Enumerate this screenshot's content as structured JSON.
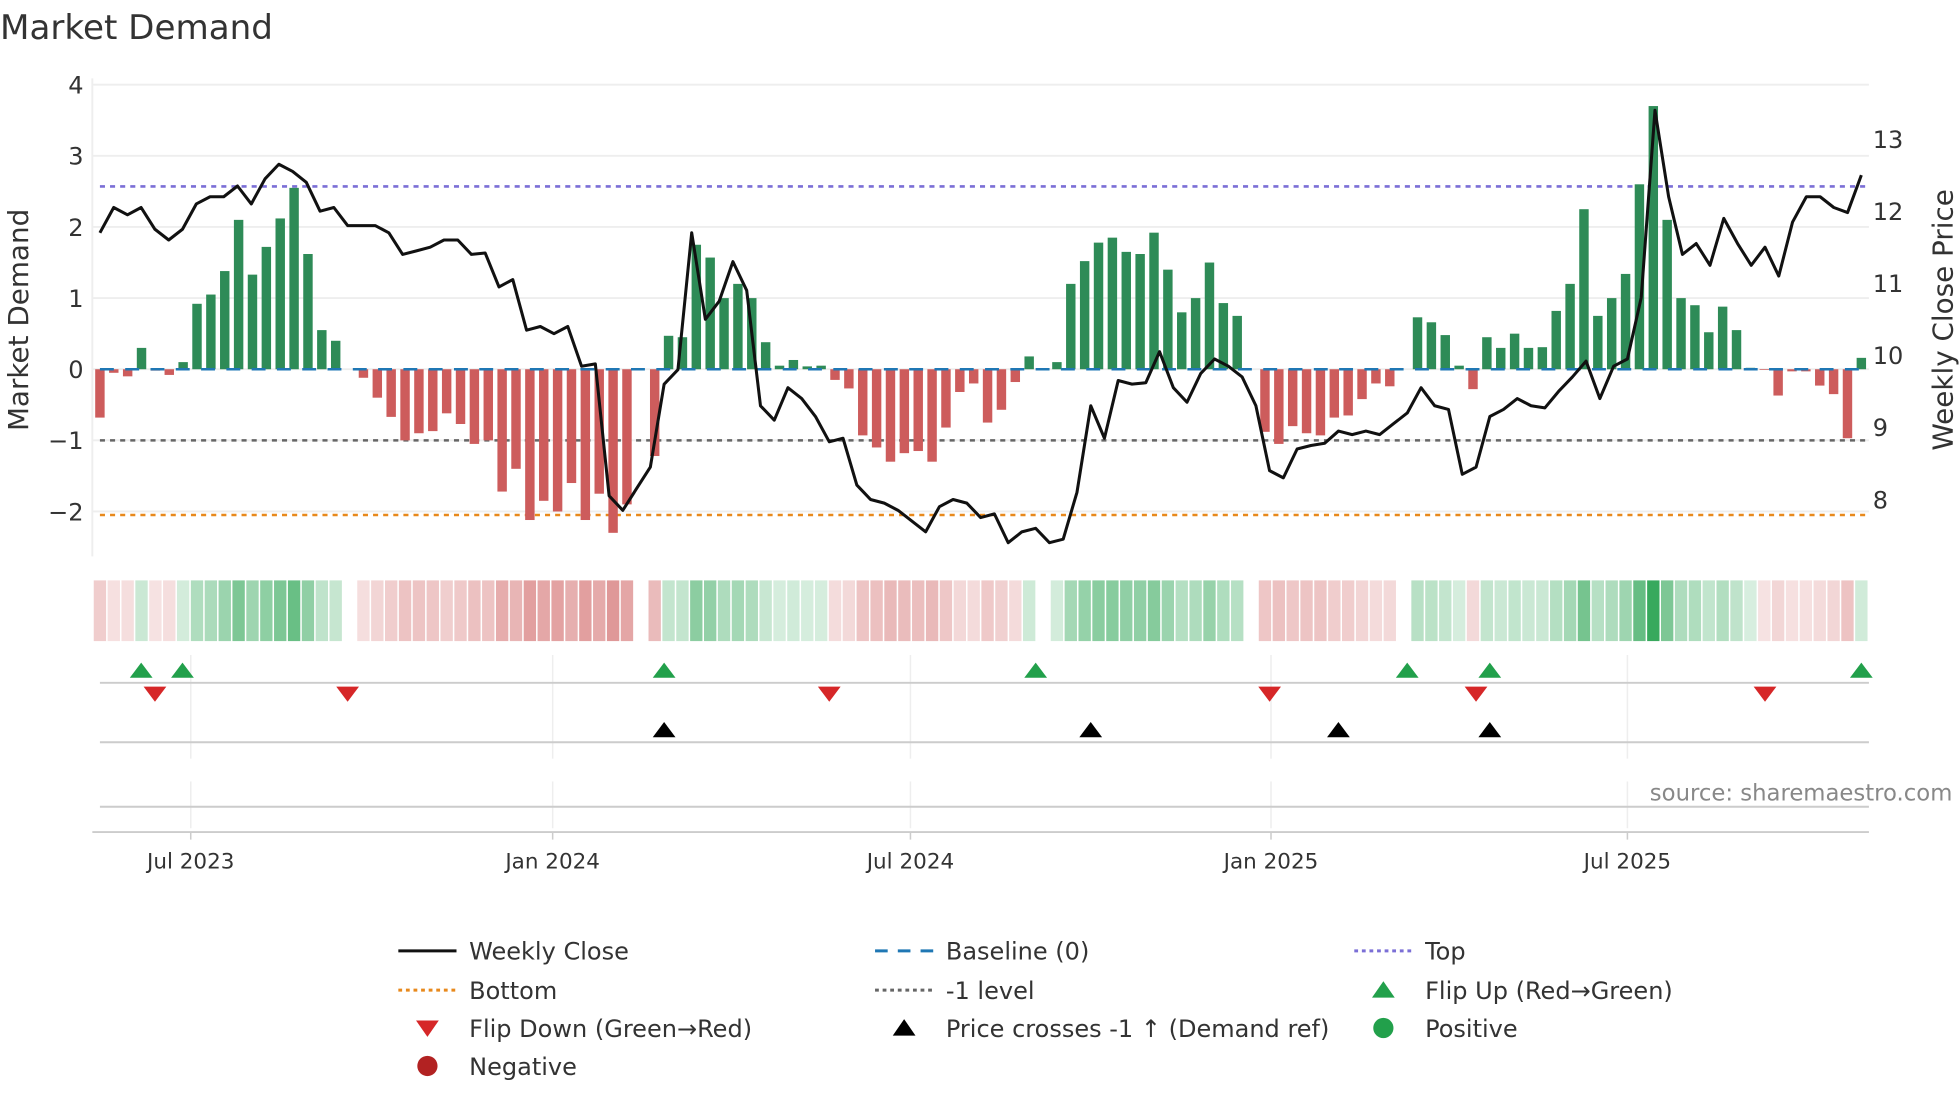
{
  "title": "Market Demand",
  "source": "source: sharemaestro.com",
  "colors": {
    "positive": "#2e8b57",
    "negative": "#cd5c5c",
    "price": "#111111",
    "baseline": "#1f77b4",
    "top": "#7b6fd6",
    "bottom": "#e8891c",
    "minus_one": "#666666",
    "flip_up": "#22a04b",
    "flip_down": "#d62728",
    "cross": "#000000",
    "negative_dot": "#b22222"
  },
  "chart_data": {
    "type": "bar",
    "title": "Market Demand",
    "ylabel": "Market Demand",
    "y2label": "Weekly Close Price",
    "ylim": [
      -2.7,
      4.1
    ],
    "y2lim": [
      7.15,
      13.85
    ],
    "yticks": [
      "4",
      "3",
      "2",
      "1",
      "0",
      "−1",
      "−2"
    ],
    "ytick_values": [
      4,
      3,
      2,
      1,
      0,
      -1,
      -2
    ],
    "y2ticks": [
      "13",
      "12",
      "11",
      "10",
      "9",
      "8"
    ],
    "y2tick_values": [
      13,
      12,
      11,
      10,
      9,
      8
    ],
    "xticks": [
      "Jul 2023",
      "Jan 2024",
      "Jul 2024",
      "Jan 2025",
      "Jul 2025"
    ],
    "xtick_weeks": [
      6.6,
      32.9,
      58.9,
      85.1,
      111.0
    ],
    "weeks_total": 128,
    "levels": {
      "top": 2.57,
      "bottom": -2.05,
      "minus_one": -1.0,
      "baseline": 0
    },
    "demand": [
      -0.68,
      -0.05,
      -0.1,
      0.3,
      -0.02,
      -0.08,
      0.1,
      0.92,
      1.05,
      1.38,
      2.1,
      1.33,
      1.72,
      2.12,
      2.55,
      1.62,
      0.55,
      0.4,
      0,
      -0.12,
      -0.4,
      -0.67,
      -1.0,
      -0.9,
      -0.87,
      -0.62,
      -0.77,
      -1.05,
      -1.0,
      -1.72,
      -1.4,
      -2.12,
      -1.85,
      -2.0,
      -1.6,
      -2.12,
      -1.75,
      -2.3,
      -1.9,
      0,
      -1.22,
      0.47,
      0.45,
      1.75,
      1.57,
      1.0,
      1.2,
      1.0,
      0.38,
      0.05,
      0.13,
      0.04,
      0.05,
      -0.15,
      -0.27,
      -0.93,
      -1.1,
      -1.3,
      -1.18,
      -1.15,
      -1.3,
      -0.82,
      -0.32,
      -0.2,
      -0.75,
      -0.57,
      -0.18,
      0.18,
      0.0,
      0.1,
      1.2,
      1.52,
      1.78,
      1.85,
      1.65,
      1.62,
      1.92,
      1.4,
      0.8,
      1.0,
      1.5,
      0.93,
      0.75,
      0.0,
      -0.88,
      -1.05,
      -0.8,
      -0.9,
      -0.93,
      -0.68,
      -0.65,
      -0.42,
      -0.2,
      -0.24,
      0.0,
      0.73,
      0.66,
      0.48,
      0.05,
      -0.28,
      0.45,
      0.3,
      0.5,
      0.3,
      0.31,
      0.82,
      1.2,
      2.25,
      0.75,
      1.0,
      1.34,
      2.6,
      3.7,
      2.1,
      1.0,
      0.9,
      0.52,
      0.88,
      0.55,
      0.02,
      -0.01,
      -0.37,
      -0.03,
      -0.03,
      -0.23,
      -0.35,
      -0.97,
      0.16
    ],
    "price": [
      11.7,
      12.05,
      11.95,
      12.05,
      11.75,
      11.6,
      11.75,
      12.1,
      12.2,
      12.2,
      12.35,
      12.1,
      12.45,
      12.65,
      12.55,
      12.4,
      12.0,
      12.05,
      11.8,
      11.8,
      11.8,
      11.7,
      11.4,
      11.45,
      11.5,
      11.6,
      11.6,
      11.4,
      11.42,
      10.95,
      11.05,
      10.35,
      10.4,
      10.3,
      10.4,
      9.85,
      9.88,
      8.05,
      7.85,
      8.15,
      8.45,
      9.6,
      9.8,
      11.7,
      10.5,
      10.75,
      11.3,
      10.9,
      9.3,
      9.1,
      9.55,
      9.4,
      9.15,
      8.8,
      8.85,
      8.2,
      8.0,
      7.95,
      7.85,
      7.7,
      7.55,
      7.9,
      8.0,
      7.95,
      7.75,
      7.8,
      7.4,
      7.55,
      7.6,
      7.4,
      7.45,
      8.1,
      9.3,
      8.85,
      9.65,
      9.6,
      9.62,
      10.05,
      9.55,
      9.35,
      9.75,
      9.95,
      9.85,
      9.7,
      9.3,
      8.4,
      8.3,
      8.7,
      8.75,
      8.78,
      8.95,
      8.9,
      8.95,
      8.9,
      9.05,
      9.2,
      9.55,
      9.3,
      9.25,
      8.35,
      8.45,
      9.15,
      9.25,
      9.4,
      9.3,
      9.27,
      9.5,
      9.7,
      9.92,
      9.4,
      9.85,
      9.95,
      10.8,
      13.4,
      12.2,
      11.4,
      11.55,
      11.25,
      11.9,
      11.55,
      11.25,
      11.5,
      11.1,
      11.85,
      12.2,
      12.2,
      12.05,
      11.98,
      12.5
    ],
    "events": {
      "flip_up_weeks": [
        3,
        6,
        41,
        68,
        95,
        101,
        128
      ],
      "flip_down_weeks": [
        4,
        18,
        53,
        85,
        100,
        121
      ],
      "price_cross_weeks": [
        41,
        72,
        90,
        101
      ]
    }
  },
  "legend": {
    "placement": "bottom",
    "items": [
      {
        "label": "Weekly Close",
        "kind": "line-solid",
        "color_key": "price"
      },
      {
        "label": "Baseline (0)",
        "kind": "line-dash",
        "color_key": "baseline"
      },
      {
        "label": "Top",
        "kind": "line-dot",
        "color_key": "top"
      },
      {
        "label": "Bottom",
        "kind": "line-dot",
        "color_key": "bottom"
      },
      {
        "label": "-1 level",
        "kind": "line-dot",
        "color_key": "minus_one"
      },
      {
        "label": "Flip Up (Red→Green)",
        "kind": "tri-up",
        "color_key": "flip_up"
      },
      {
        "label": "Flip Down (Green→Red)",
        "kind": "tri-down",
        "color_key": "flip_down"
      },
      {
        "label": "Price crosses -1 ↑ (Demand ref)",
        "kind": "tri-up",
        "color_key": "cross"
      },
      {
        "label": "Positive",
        "kind": "dot",
        "color_key": "flip_up"
      },
      {
        "label": "Negative",
        "kind": "dot",
        "color_key": "negative_dot"
      }
    ]
  }
}
